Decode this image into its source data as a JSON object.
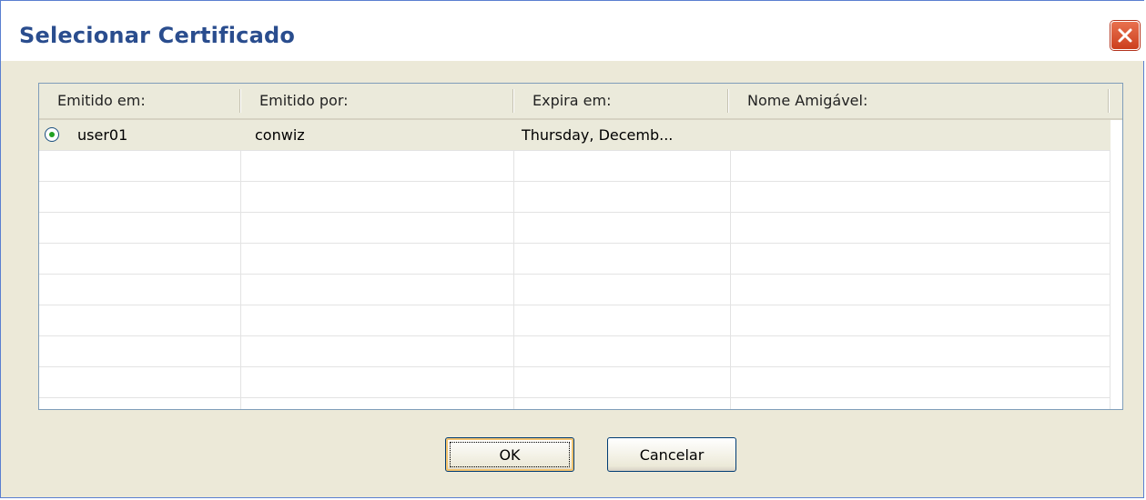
{
  "window": {
    "title": "Selecionar Certificado",
    "close_icon": "close-icon"
  },
  "table": {
    "columns": [
      "Emitido em:",
      "Emitido por:",
      "Expira em:",
      "Nome Amigável:"
    ],
    "rows": [
      {
        "selected": true,
        "issued_to": "user01",
        "issued_by": "conwiz",
        "expires": "Thursday, Decemb...",
        "friendly_name": ""
      }
    ]
  },
  "buttons": {
    "ok": "OK",
    "cancel": "Cancelar"
  },
  "colors": {
    "title_text": "#2a4d8e",
    "close_button": "#d9532f",
    "dialog_background": "#ece9d8",
    "selected_row": "#ebeadb",
    "radio_dot": "#21a121"
  }
}
